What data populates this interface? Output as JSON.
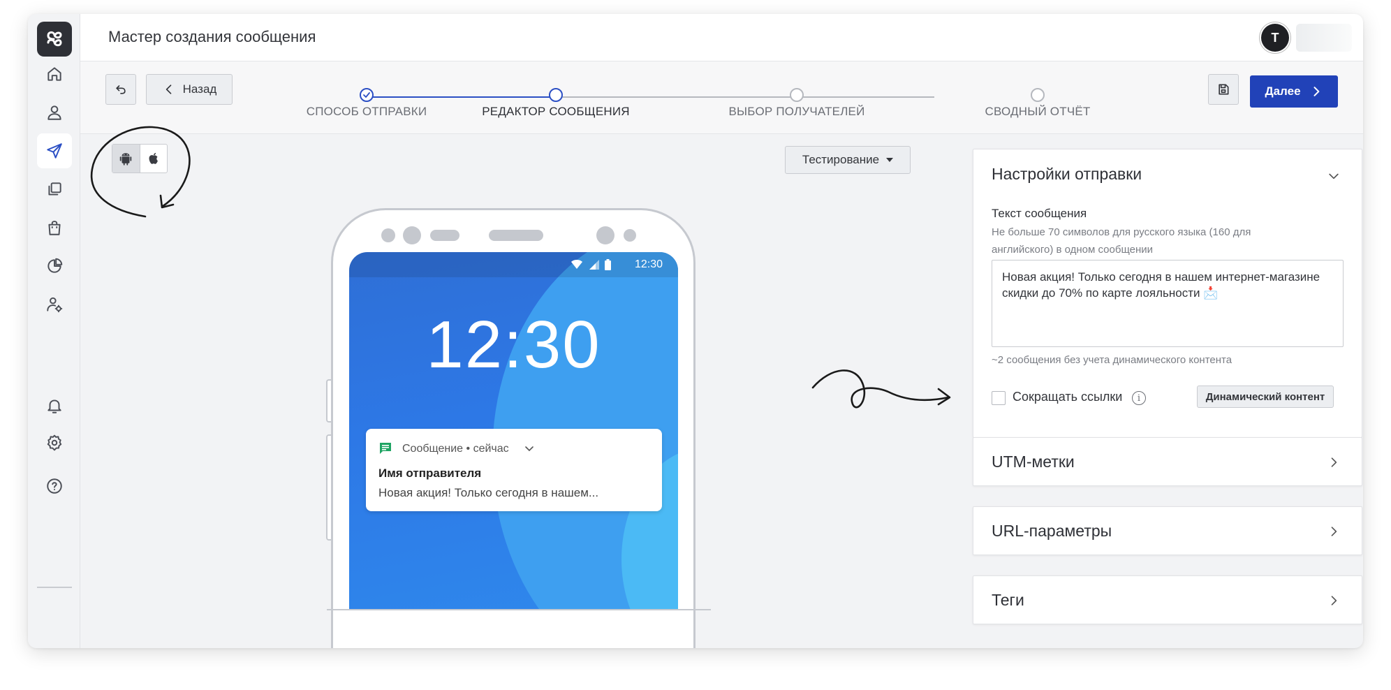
{
  "header": {
    "title": "Мастер создания сообщения",
    "avatar_initial": "Т"
  },
  "sidebar": {
    "items": [
      {
        "name": "home-icon"
      },
      {
        "name": "user-icon"
      },
      {
        "name": "send-icon",
        "active": true
      },
      {
        "name": "copy-icon"
      },
      {
        "name": "shopping-bag-icon"
      },
      {
        "name": "pie-chart-icon"
      },
      {
        "name": "user-settings-icon"
      }
    ],
    "bottom": [
      {
        "name": "bell-icon"
      },
      {
        "name": "gear-icon"
      },
      {
        "name": "help-icon",
        "glyph": "?"
      }
    ]
  },
  "toolbar": {
    "back_label": "Назад",
    "next_label": "Далее"
  },
  "steps": [
    {
      "label": "СПОСОБ ОТПРАВКИ",
      "state": "done"
    },
    {
      "label": "РЕДАКТОР СООБЩЕНИЯ",
      "state": "current"
    },
    {
      "label": "ВЫБОР ПОЛУЧАТЕЛЕЙ",
      "state": "pending"
    },
    {
      "label": "СВОДНЫЙ ОТЧЁТ",
      "state": "pending"
    }
  ],
  "preview": {
    "platforms": [
      "android-icon",
      "apple-icon"
    ],
    "selected_platform": "android",
    "test_dropdown": "Тестирование",
    "status_time": "12:30",
    "lock_time": "12:30",
    "notification": {
      "app_line": "Сообщение • сейчас",
      "sender": "Имя отправителя",
      "body": "Новая акция! Только сегодня в нашем..."
    }
  },
  "settings": {
    "title": "Настройки отправки",
    "text_label": "Текст сообщения",
    "text_hint": "Не больше 70 символов для русского языка (160 для английского) в одном сообщении",
    "message_text": "Новая акция! Только сегодня в нашем интернет-магазине скидки до 70% по карте лояльности 📩",
    "count_hint": "~2 сообщения без учета динамического контента",
    "shorten_links_label": "Сокращать ссылки",
    "shorten_links_checked": false,
    "dynamic_button": "Динамический контент"
  },
  "sections": [
    {
      "title": "UTM-метки"
    },
    {
      "title": "URL-параметры"
    },
    {
      "title": "Теги"
    }
  ],
  "colors": {
    "accent": "#2142b8",
    "screen": "#2d78e6",
    "notif_icon": "#1fa463"
  }
}
